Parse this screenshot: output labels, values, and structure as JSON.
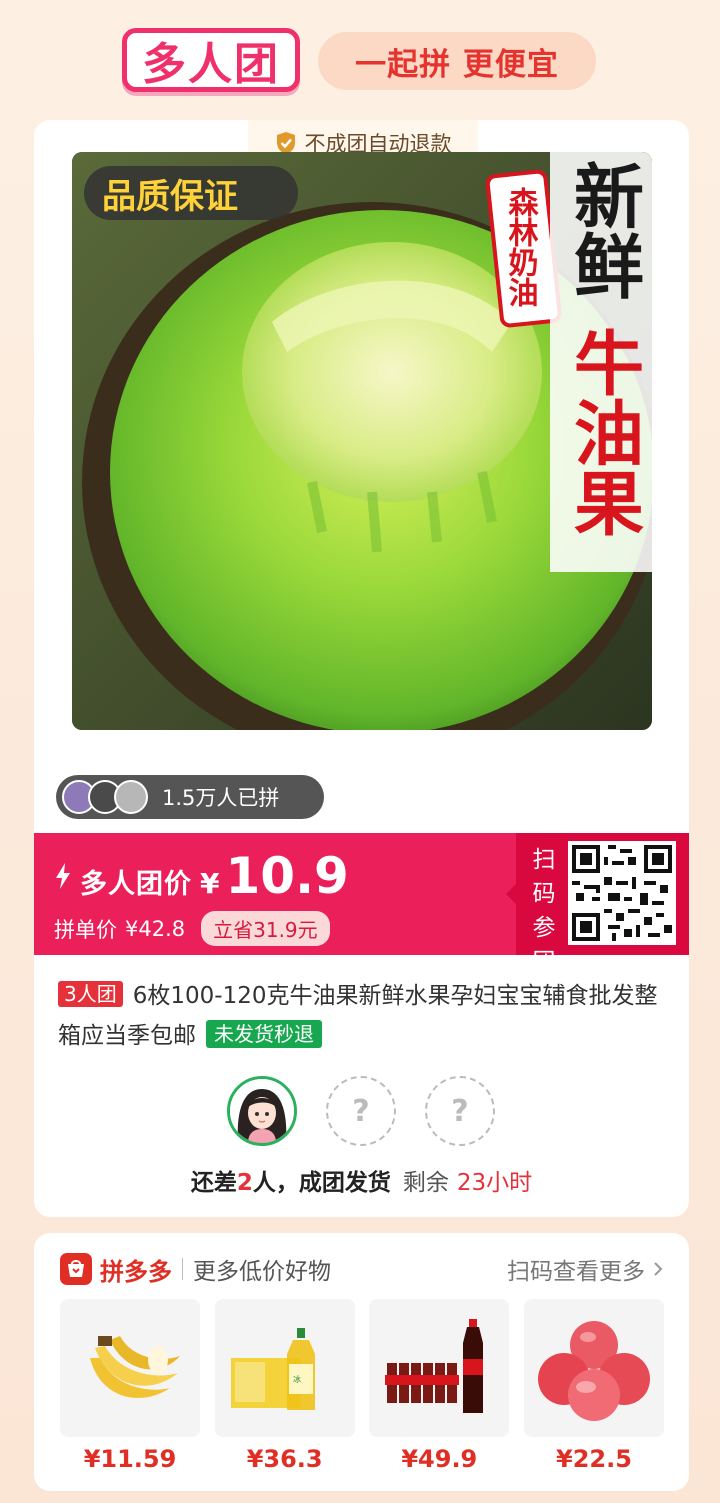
{
  "header": {
    "logo_text": "多人团",
    "slogan": "一起拼 更便宜"
  },
  "product": {
    "refund_badge": "不成团自动退款",
    "photo_text": {
      "quality": "品质保证",
      "badge": "森林奶油",
      "line1": "新鲜",
      "line2": "牛油果"
    },
    "joined_count": "1.5万人已拼",
    "group_price_label": "多人团价",
    "currency": "¥",
    "group_price": "10.9",
    "single_price_label": "拼单价",
    "single_price": "¥42.8",
    "save_text": "立省31.9元",
    "scan_join": "扫码参团",
    "group_tag": "3人团",
    "title": "6枚100-120克牛油果新鲜水果孕妇宝宝辅食批发整箱应当季包邮",
    "fast_refund_tag": "未发货秒退",
    "placeholder_member": "?",
    "status": {
      "prefix": "还差",
      "count": "2",
      "suffix": "人，成团发货",
      "remaining_label": "剩余",
      "remaining_time": "23小时"
    }
  },
  "recommend": {
    "brand": "拼多多",
    "more_label": "更多低价好物",
    "scan_more": "扫码查看更多",
    "items": [
      {
        "name": "banana",
        "price": "¥11.59"
      },
      {
        "name": "drink-box",
        "price": "¥36.3"
      },
      {
        "name": "cola",
        "price": "¥49.9"
      },
      {
        "name": "apples",
        "price": "¥22.5"
      }
    ]
  },
  "colors": {
    "accent": "#eb1f5a",
    "brand": "#e02e24",
    "green": "#17a84f"
  }
}
